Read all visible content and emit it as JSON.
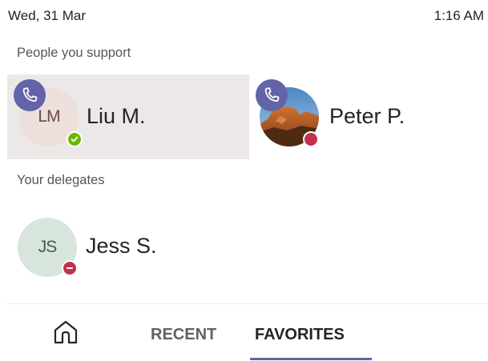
{
  "status_bar": {
    "date": "Wed, 31 Mar",
    "time": "1:16 AM"
  },
  "sections": {
    "support_label": "People you support",
    "delegates_label": "Your delegates"
  },
  "people_you_support": [
    {
      "name": "Liu M.",
      "initials": "LM",
      "presence": "available",
      "presence_color": "#6bb700",
      "call_badge": "phone-icon",
      "selected": true
    },
    {
      "name": "Peter P.",
      "presence": "busy",
      "presence_color": "#c4314b",
      "call_badge": "phone-icon",
      "avatar": "photo"
    }
  ],
  "delegates": [
    {
      "name": "Jess S.",
      "initials": "JS",
      "presence": "do-not-disturb",
      "presence_color": "#c4314b"
    }
  ],
  "nav": {
    "home_icon": "home-icon",
    "tabs": [
      {
        "label": "RECENT",
        "active": false
      },
      {
        "label": "FAVORITES",
        "active": true
      }
    ]
  },
  "colors": {
    "accent": "#6264a7",
    "selected_bg": "#ebe8e7",
    "available": "#6bb700",
    "busy": "#c4314b"
  }
}
